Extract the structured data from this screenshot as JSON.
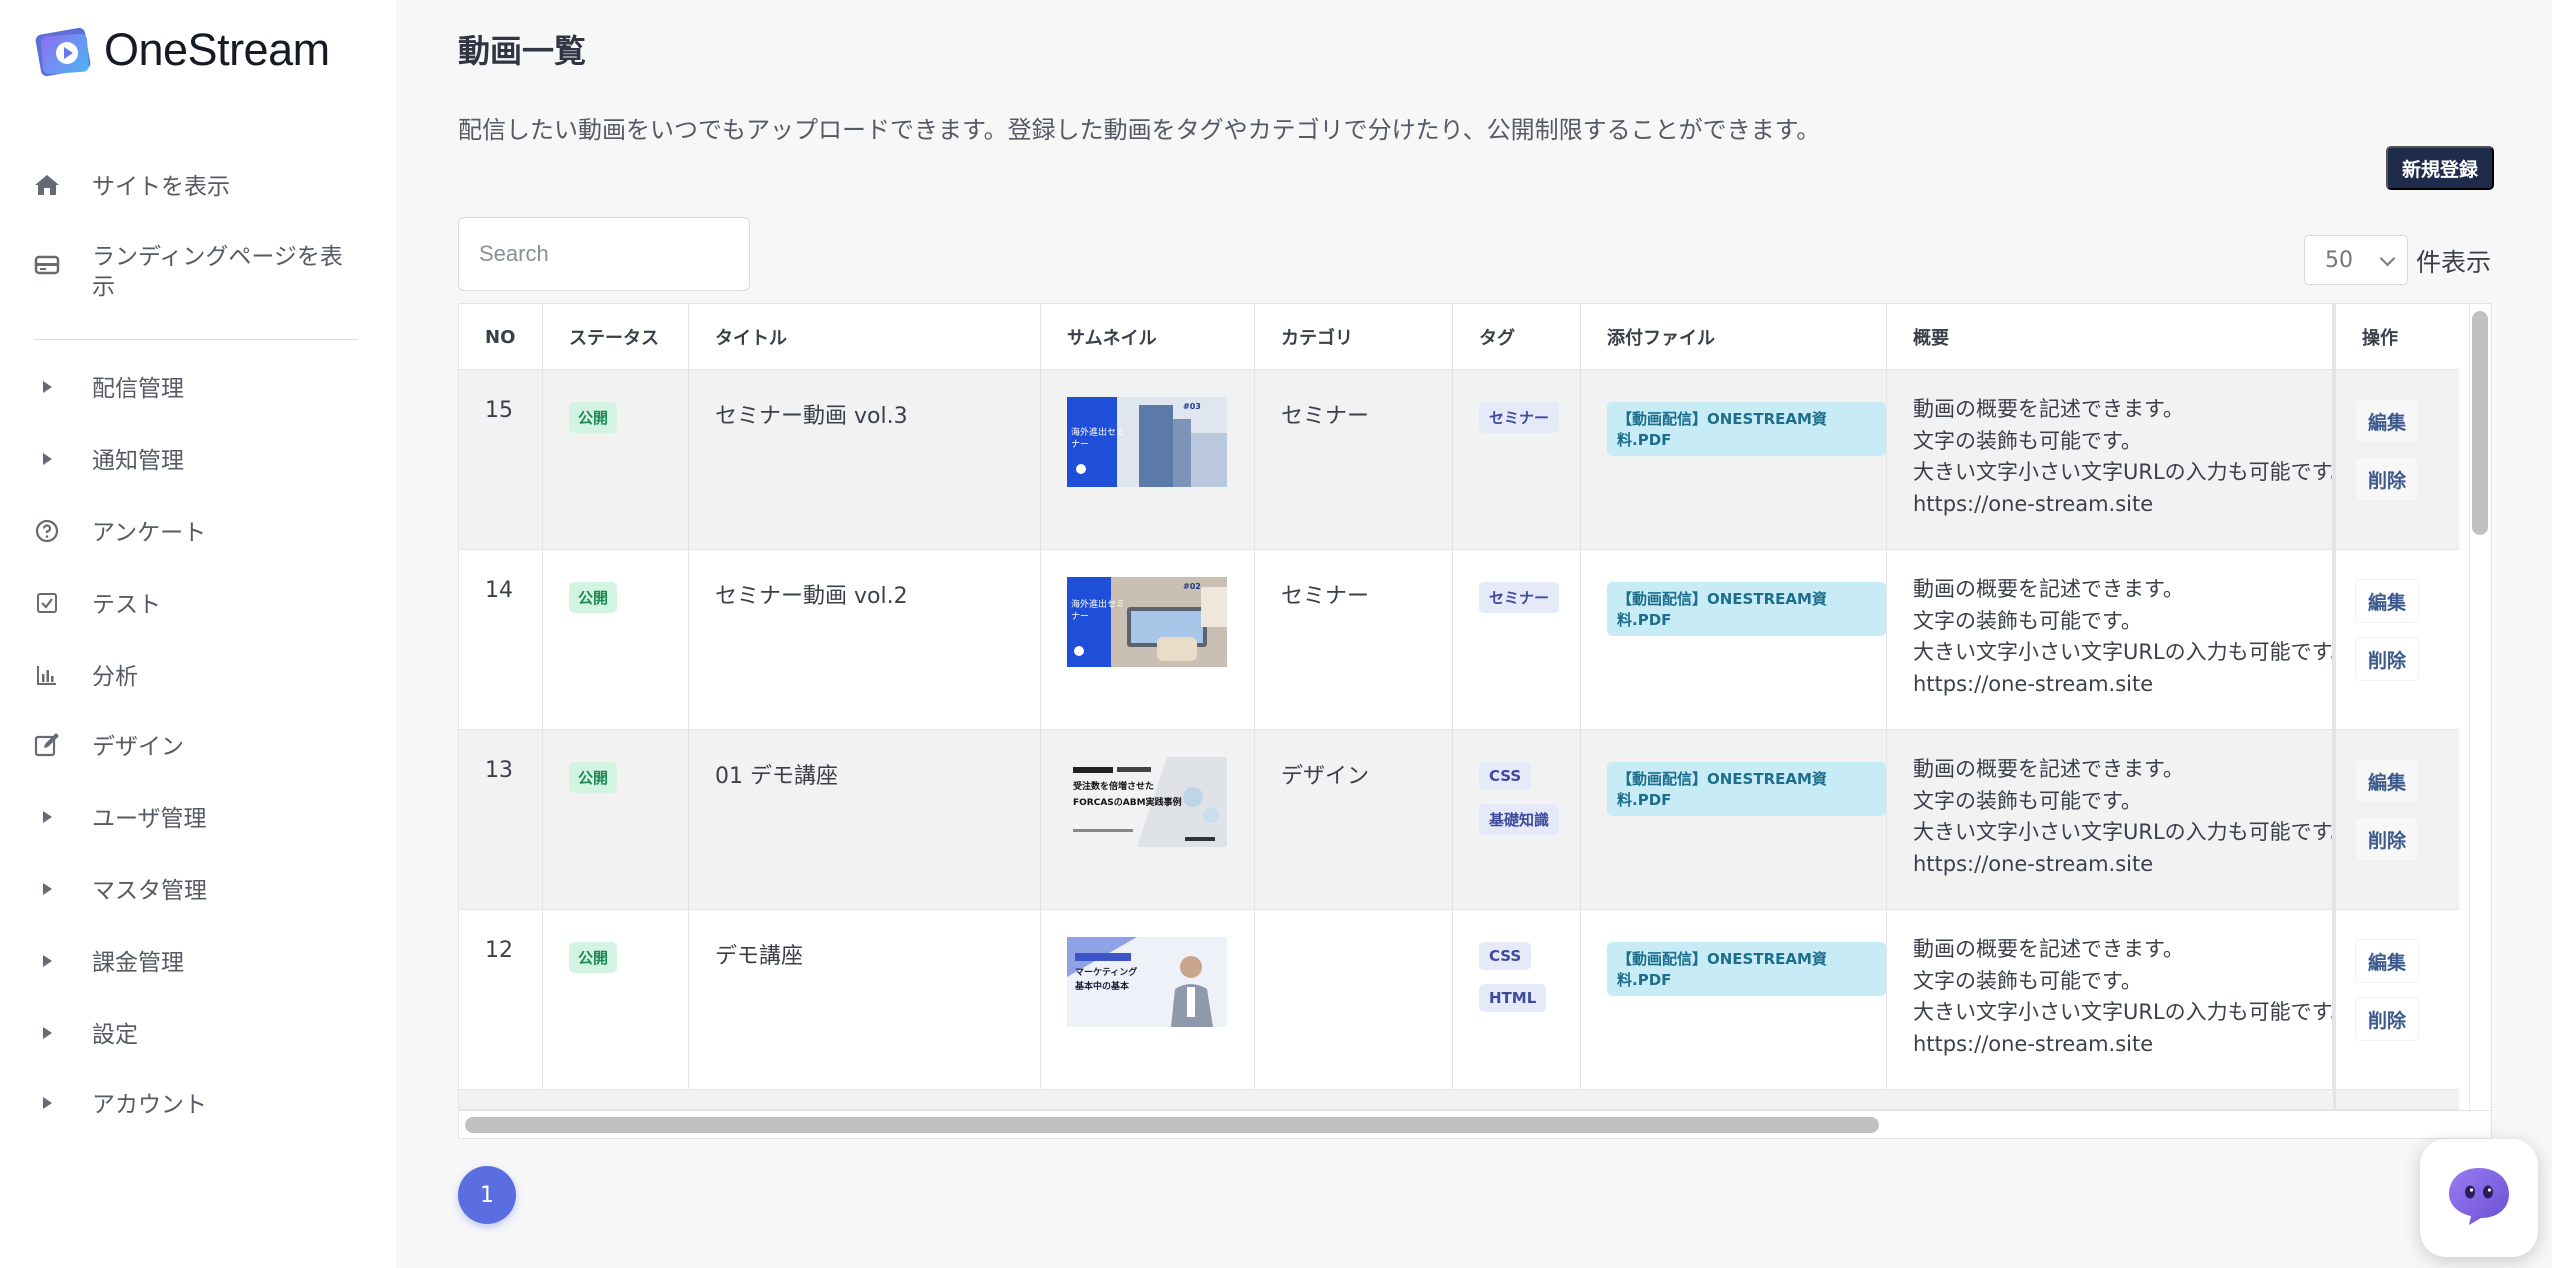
{
  "brand": {
    "name": "OneStream"
  },
  "sidebar": {
    "items": [
      {
        "label": "サイトを表示",
        "icon": "home-icon"
      },
      {
        "label": "ランディングページを表示",
        "icon": "landing-page-icon"
      },
      {
        "label": "配信管理",
        "icon": "caret-right-icon"
      },
      {
        "label": "通知管理",
        "icon": "caret-right-icon"
      },
      {
        "label": "アンケート",
        "icon": "question-circle-icon"
      },
      {
        "label": "テスト",
        "icon": "checkbox-icon"
      },
      {
        "label": "分析",
        "icon": "bar-chart-icon"
      },
      {
        "label": "デザイン",
        "icon": "edit-icon"
      },
      {
        "label": "ユーザ管理",
        "icon": "caret-right-icon"
      },
      {
        "label": "マスタ管理",
        "icon": "caret-right-icon"
      },
      {
        "label": "課金管理",
        "icon": "caret-right-icon"
      },
      {
        "label": "設定",
        "icon": "caret-right-icon"
      },
      {
        "label": "アカウント",
        "icon": "caret-right-icon"
      }
    ]
  },
  "main": {
    "title": "動画一覧",
    "description": "配信したい動画をいつでもアップロードできます。登録した動画をタグやカテゴリで分けたり、公開制限することができます。",
    "new_button": "新規登録",
    "search_placeholder": "Search",
    "per_page_value": "50",
    "per_page_suffix": "件表示",
    "page_number": "1"
  },
  "table": {
    "columns": [
      "NO",
      "ステータス",
      "タイトル",
      "サムネイル",
      "カテゴリ",
      "タグ",
      "添付ファイル",
      "概要",
      "操作"
    ],
    "edit_label": "編集",
    "delete_label": "削除",
    "rows": [
      {
        "no": "15",
        "status": "公開",
        "title": "セミナー動画 vol.3",
        "category": "セミナー",
        "tags": [
          "セミナー"
        ],
        "file": "【動画配信】ONESTREAM資料.PDF",
        "thumb_text": "海外進出セミナー",
        "thumb_badge": "#03",
        "summary": [
          "動画の概要を記述できます。",
          "文字の装飾も可能です。",
          "大きい文字小さい文字URLの入力も可能です。",
          "https://one-stream.site"
        ]
      },
      {
        "no": "14",
        "status": "公開",
        "title": "セミナー動画 vol.2",
        "category": "セミナー",
        "tags": [
          "セミナー"
        ],
        "file": "【動画配信】ONESTREAM資料.PDF",
        "thumb_text": "海外進出セミナー",
        "thumb_badge": "#02",
        "summary": [
          "動画の概要を記述できます。",
          "文字の装飾も可能です。",
          "大きい文字小さい文字URLの入力も可能です。",
          "https://one-stream.site"
        ]
      },
      {
        "no": "13",
        "status": "公開",
        "title": "01 デモ講座",
        "category": "デザイン",
        "tags": [
          "CSS",
          "基礎知識"
        ],
        "file": "【動画配信】ONESTREAM資料.PDF",
        "thumb_text": "受注数を倍増させた FORCASのABM実践事例",
        "thumb_badge": "",
        "summary": [
          "動画の概要を記述できます。",
          "文字の装飾も可能です。",
          "大きい文字小さい文字URLの入力も可能です。",
          "https://one-stream.site"
        ]
      },
      {
        "no": "12",
        "status": "公開",
        "title": "デモ講座",
        "category": "",
        "tags": [
          "CSS",
          "HTML"
        ],
        "file": "【動画配信】ONESTREAM資料.PDF",
        "thumb_text": "マーケティング 基本中の基本",
        "thumb_badge": "",
        "summary": [
          "動画の概要を記述できます。",
          "文字の装飾も可能です。",
          "大きい文字小さい文字URLの入力も可能です。",
          "https://one-stream.site"
        ]
      }
    ]
  },
  "colors": {
    "accent": "#5b6ee1",
    "primary_button": "#1e2b4a",
    "status_bg": "#d3f3e3",
    "tag_bg": "#e6e9f8",
    "file_bg": "#c8ecf6"
  }
}
